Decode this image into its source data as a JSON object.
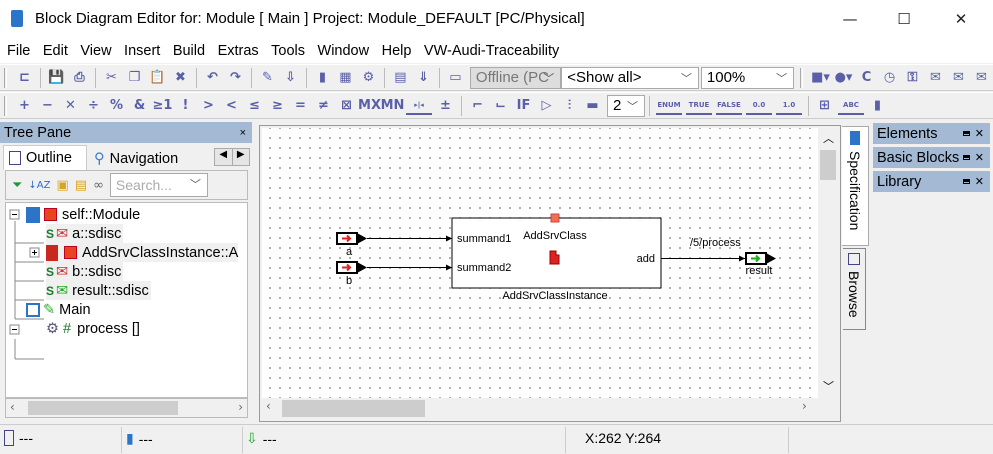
{
  "window": {
    "title": "Block Diagram Editor for: Module [ Main ] Project: Module_DEFAULT [PC/Physical]",
    "minimize": "—",
    "maximize": "☐",
    "close": "✕"
  },
  "menu": [
    "File",
    "Edit",
    "View",
    "Insert",
    "Build",
    "Extras",
    "Tools",
    "Window",
    "Help",
    "VW-Audi-Traceability"
  ],
  "toolbar1": {
    "icons_a": [
      {
        "name": "connect-icon",
        "g": "⊏"
      },
      {
        "name": "save-icon",
        "g": "💾"
      },
      {
        "name": "print-icon",
        "g": "⎙"
      },
      {
        "name": "cut-icon",
        "g": "✂"
      },
      {
        "name": "copy-icon",
        "g": "❐"
      },
      {
        "name": "paste-icon",
        "g": "📋"
      },
      {
        "name": "delete-icon",
        "g": "✖"
      },
      {
        "name": "undo-icon",
        "g": "↶"
      },
      {
        "name": "redo-icon",
        "g": "↷"
      },
      {
        "name": "edit-properties-icon",
        "g": "✎"
      },
      {
        "name": "download-properties-icon",
        "g": "⇩"
      },
      {
        "name": "add-class-icon",
        "g": "▮"
      },
      {
        "name": "add-block-icon",
        "g": "▦"
      },
      {
        "name": "add-service-icon",
        "g": "⚙"
      },
      {
        "name": "open-spec-icon",
        "g": "▤"
      },
      {
        "name": "import-spec-icon",
        "g": "⇓"
      },
      {
        "name": "offline-icon",
        "g": "▭"
      }
    ],
    "mode_select": "Offline (PC",
    "filter_select": "<Show all>",
    "zoom_select": "100%",
    "icons_b": [
      {
        "name": "add-block-dropdown-icon",
        "g": "■▾"
      },
      {
        "name": "add-service-dropdown-icon",
        "g": "●▾"
      },
      {
        "name": "add-constant-icon",
        "g": "C"
      },
      {
        "name": "add-timer-icon",
        "g": "◷"
      },
      {
        "name": "add-key-icon",
        "g": "⚿"
      },
      {
        "name": "add-inport-icon",
        "g": "✉"
      },
      {
        "name": "add-message-icon",
        "g": "✉"
      },
      {
        "name": "add-outport-icon",
        "g": "✉"
      }
    ]
  },
  "toolbar2": {
    "icons_a": [
      {
        "name": "plus-icon",
        "g": "+"
      },
      {
        "name": "minus-icon",
        "g": "−"
      },
      {
        "name": "multiply-icon",
        "g": "✕"
      },
      {
        "name": "divide-icon",
        "g": "÷"
      },
      {
        "name": "modulo-icon",
        "g": "%"
      },
      {
        "name": "and-icon",
        "g": "&"
      },
      {
        "name": "or-icon",
        "g": "≥1"
      },
      {
        "name": "not-icon",
        "g": "!"
      },
      {
        "name": "greater-icon",
        "g": ">"
      },
      {
        "name": "less-icon",
        "g": "<"
      },
      {
        "name": "less-equal-icon",
        "g": "≤"
      },
      {
        "name": "greater-equal-icon",
        "g": "≥"
      },
      {
        "name": "equal-icon",
        "g": "="
      },
      {
        "name": "not-equal-icon",
        "g": "≠"
      },
      {
        "name": "multiplexer-icon",
        "g": "⊠"
      },
      {
        "name": "max-icon",
        "g": "MX"
      },
      {
        "name": "min-icon",
        "g": "MN"
      },
      {
        "name": "split-icon",
        "g": "▸|◂"
      },
      {
        "name": "plus-minus-icon",
        "g": "±"
      },
      {
        "name": "connector-icon",
        "g": "⌐"
      },
      {
        "name": "connector-2-icon",
        "g": "⌙"
      },
      {
        "name": "if-icon",
        "g": "IF"
      },
      {
        "name": "switch-icon",
        "g": "▷"
      },
      {
        "name": "bus-icon",
        "g": "⫶"
      },
      {
        "name": "terminal-icon",
        "g": "▬"
      }
    ],
    "count_select": "2",
    "icons_b": [
      {
        "name": "enum-icon",
        "g": "ENUM"
      },
      {
        "name": "true-icon",
        "g": "TRUE"
      },
      {
        "name": "false-icon",
        "g": "FALSE"
      },
      {
        "name": "zero-icon",
        "g": "0.0"
      },
      {
        "name": "one-icon",
        "g": "1.0"
      },
      {
        "name": "hierarchy-icon",
        "g": "⊞"
      },
      {
        "name": "text-icon",
        "g": "ABC"
      },
      {
        "name": "book-icon",
        "g": "▮"
      }
    ]
  },
  "tree_pane": {
    "title": "Tree Pane",
    "close": "×",
    "tabs": [
      "Outline",
      "Navigation"
    ],
    "search_placeholder": "Search...",
    "items": [
      {
        "label": "self::Module"
      },
      {
        "label": "a::sdisc"
      },
      {
        "label": "AddSrvClassInstance::A"
      },
      {
        "label": "b::sdisc"
      },
      {
        "label": "result::sdisc"
      },
      {
        "label": "Main"
      },
      {
        "label": "process []"
      }
    ]
  },
  "diagram": {
    "block_class": "AddSrvClass",
    "block_instance": "AddSrvClassInstance",
    "inputs": [
      "summand1",
      "summand2"
    ],
    "output": "add",
    "ports_in": [
      "a",
      "b"
    ],
    "port_out": "result",
    "signal_label": "/5/process"
  },
  "side_tabs": [
    "Specification",
    "Browse"
  ],
  "right_panels": [
    "Elements",
    "Basic Blocks",
    "Library"
  ],
  "status": {
    "s1": "---",
    "s2": "---",
    "s3": "---",
    "coords": "X:262 Y:264"
  },
  "colors": {
    "panel_header": "#a3b9d4",
    "block_red": "#e9431f"
  }
}
